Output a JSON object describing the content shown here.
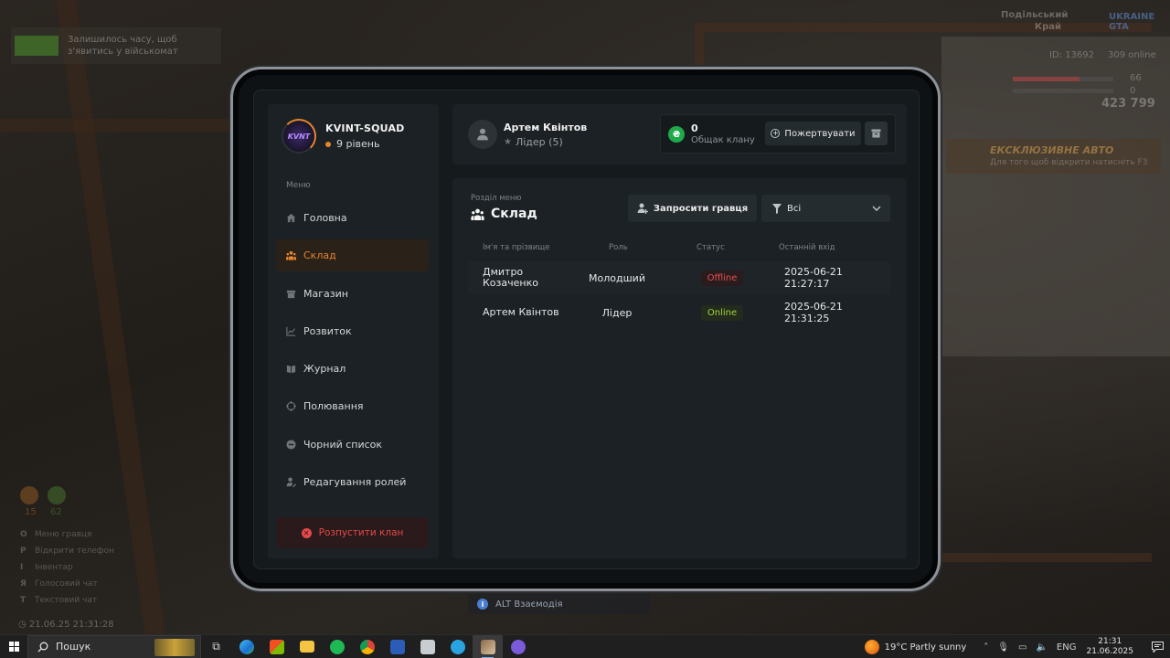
{
  "hud": {
    "notice": "Залишилось часу, щоб з'явитись у військомат",
    "region": "Подільський Край",
    "server_logo": "UKRAINE GTA",
    "player_id": "ID: 13692",
    "online": "309 online",
    "health": "66",
    "armor": "0",
    "money": "423 799",
    "exclusive_title": "ЕКСКЛЮЗИВНЕ АВТО",
    "exclusive_sub": "Для того щоб відкрити натисніть",
    "exclusive_key": "F3",
    "stat_1": "15",
    "stat_2": "62",
    "keys": [
      {
        "key": "O",
        "label": "Меню гравця"
      },
      {
        "key": "P",
        "label": "Відкрити телефон"
      },
      {
        "key": "I",
        "label": "Інвентар"
      },
      {
        "key": "Я",
        "label": "Голосовий чат"
      },
      {
        "key": "T",
        "label": "Текстовий чат"
      }
    ],
    "datetime": "21.06.25 21:31:28",
    "alt_hint": "ALT Взаємодія"
  },
  "clan": {
    "name": "KVINT-SQUAD",
    "level": "9 рівень",
    "logo_text": "KVNT"
  },
  "menu": {
    "title": "Меню",
    "items": [
      {
        "label": "Головна",
        "icon": "home-icon"
      },
      {
        "label": "Склад",
        "icon": "people-icon",
        "active": true
      },
      {
        "label": "Магазин",
        "icon": "shop-icon"
      },
      {
        "label": "Розвиток",
        "icon": "chart-icon"
      },
      {
        "label": "Журнал",
        "icon": "book-icon"
      },
      {
        "label": "Полювання",
        "icon": "crosshair-icon"
      },
      {
        "label": "Чорний список",
        "icon": "block-icon"
      },
      {
        "label": "Редагування ролей",
        "icon": "user-edit-icon"
      }
    ],
    "disband": "Розпустити клан"
  },
  "user": {
    "name": "Артем Квінтов",
    "role": "Лідер (5)"
  },
  "bank": {
    "currency_symbol": "₴",
    "value": "0",
    "label": "Общак клану",
    "donate": "Пожертвувати"
  },
  "section": {
    "subtitle": "Розділ меню",
    "title": "Склад",
    "invite": "Запросити гравця",
    "filter": "Всі"
  },
  "table": {
    "headers": [
      "Ім'я та прізвище",
      "Роль",
      "Статус",
      "Останній вхід"
    ],
    "rows": [
      {
        "name": "Дмитро Козаченко",
        "role": "Молодший",
        "status": "Offline",
        "last": "2025-06-21 21:27:17"
      },
      {
        "name": "Артем Квінтов",
        "role": "Лідер",
        "status": "Online",
        "last": "2025-06-21 21:31:25"
      }
    ]
  },
  "taskbar": {
    "search": "Пошук",
    "weather": "19°C  Partly sunny",
    "lang": "ENG",
    "time": "21:31",
    "date": "21.06.2025"
  },
  "colors": {
    "accent": "#e6862b",
    "danger": "#e54848",
    "online": "#a6d33c",
    "bank": "#1faa4a"
  }
}
